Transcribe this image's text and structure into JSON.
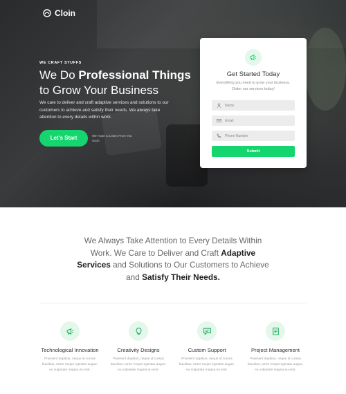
{
  "brand": {
    "name": "Cloin",
    "accent": "#15d56f"
  },
  "hero": {
    "eyebrow": "WE CRAFT STUFFS",
    "headline_part1": "We Do ",
    "headline_bold": "Professional Things",
    "headline_part2": "to Grow Your Business",
    "description": "We care to deliver and craft adaptive services and solutions to our customers to achieve and satisfy their needs. We always take attention to every details within work.",
    "cta_label": "Let's Start",
    "cta_note": "We Hope to Listen From You Soon"
  },
  "form": {
    "icon": "megaphone-icon",
    "title": "Get Started Today",
    "subtitle": "Everything you need to grow your business. Order our services today!",
    "name_placeholder": "Name",
    "email_placeholder": "Email",
    "phone_placeholder": "Phone Number",
    "submit_label": "Submit"
  },
  "statement": {
    "part1": "We Always Take Attention to Every Details Within Work. We Care to Deliver and Craft ",
    "bold1": "Adaptive Services",
    "part2": " and Solutions to Our Customers to Achieve and ",
    "bold2": "Satisfy Their Needs."
  },
  "features": [
    {
      "icon": "megaphone-icon",
      "title": "Technological Innovation",
      "desc": "Praesent dapibus, neque id cursus faucibus, tortor neque egestas augue, eu vulputate magna eu erat."
    },
    {
      "icon": "lightbulb-icon",
      "title": "Creativity Designs",
      "desc": "Praesent dapibus, neque id cursus faucibus, tortor neque egestas augue, eu vulputate magna eu erat."
    },
    {
      "icon": "chat-icon",
      "title": "Custom Support",
      "desc": "Praesent dapibus, neque id cursus faucibus, tortor neque egestas augue, eu vulputate magna eu erat."
    },
    {
      "icon": "document-icon",
      "title": "Project Management",
      "desc": "Praesent dapibus, neque id cursus faucibus, tortor neque egestas augue, eu vulputate magna eu erat."
    }
  ]
}
